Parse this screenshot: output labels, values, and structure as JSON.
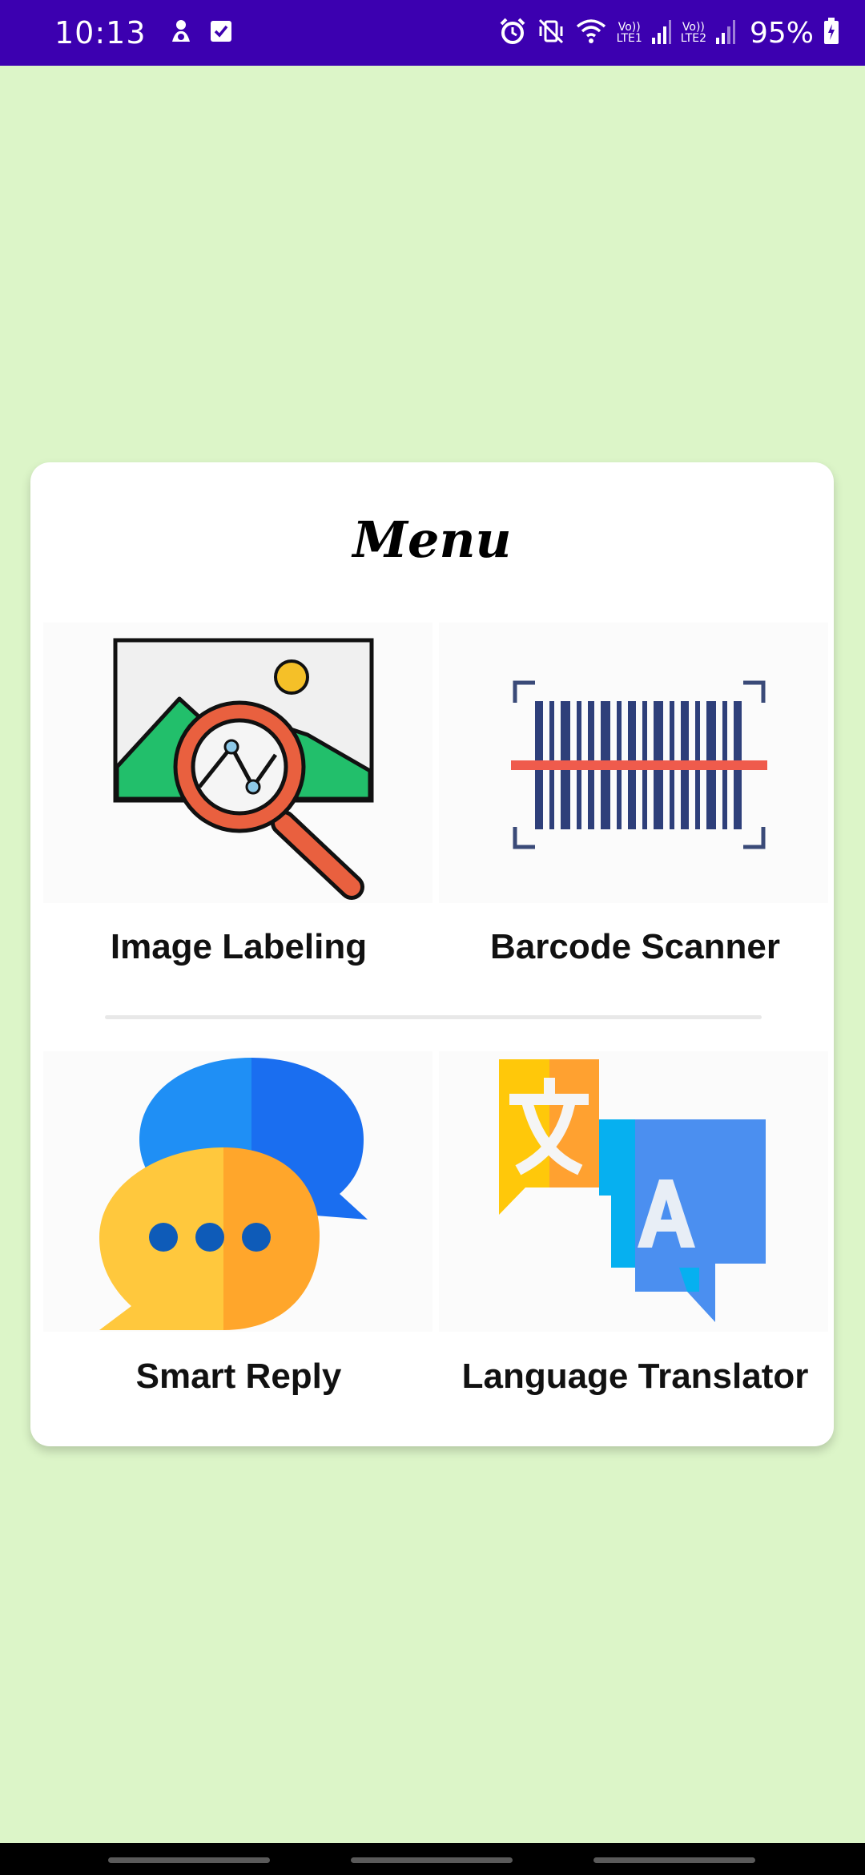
{
  "status_bar": {
    "time": "10:13",
    "left_icons": [
      "app-notification-icon",
      "checkbox-icon"
    ],
    "right_icons": [
      "alarm-icon",
      "vibrate-icon",
      "wifi-icon",
      "signal-icon",
      "signal-icon"
    ],
    "sim1_label_top": "Vo))",
    "sim1_label_bottom": "LTE1",
    "sim2_label_top": "Vo))",
    "sim2_label_bottom": "LTE2",
    "battery_percent": "95%"
  },
  "menu": {
    "title": "Menu",
    "items": [
      {
        "label": "Image Labeling",
        "icon": "image-search-icon"
      },
      {
        "label": "Barcode Scanner",
        "icon": "barcode-icon"
      },
      {
        "label": "Smart Reply",
        "icon": "chat-bubbles-icon"
      },
      {
        "label": "Language Translator",
        "icon": "translate-icon"
      }
    ]
  },
  "colors": {
    "background": "#dcf5c8",
    "status_bar": "#3c00b0",
    "card": "#ffffff"
  }
}
